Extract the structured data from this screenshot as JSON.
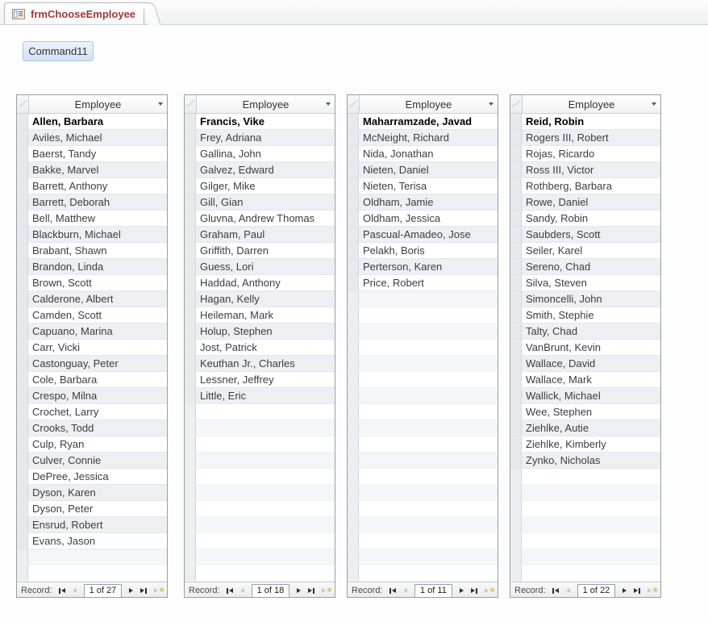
{
  "tab": {
    "label": "frmChooseEmployee",
    "icon": "form-icon"
  },
  "command_button": {
    "label": "Command11"
  },
  "navigator": {
    "record_label": "Record:"
  },
  "colors": {
    "tab_text": "#9e3a38",
    "button_fill": "#d2e2f4",
    "button_border": "#abc6e4",
    "alt_row": "#edeff4",
    "list_border": "#999da1"
  },
  "lists": [
    {
      "header": "Employee",
      "position": "1 of 27",
      "rows": [
        "Allen, Barbara",
        "Aviles, Michael",
        "Baerst, Tandy",
        "Bakke, Marvel",
        "Barrett, Anthony",
        "Barrett, Deborah",
        "Bell, Matthew",
        "Blackburn, Michael",
        "Brabant, Shawn",
        "Brandon, Linda",
        "Brown, Scott",
        "Calderone, Albert",
        "Camden, Scott",
        "Capuano, Marina",
        "Carr, Vicki",
        "Castonguay, Peter",
        "Cole, Barbara",
        "Crespo, Milna",
        "Crochet, Larry",
        "Crooks, Todd",
        "Culp, Ryan",
        "Culver, Connie",
        "DePree, Jessica",
        "Dyson, Karen",
        "Dyson, Peter",
        "Ensrud, Robert",
        "Evans, Jason"
      ]
    },
    {
      "header": "Employee",
      "position": "1 of 18",
      "rows": [
        "Francis, Vike",
        "Frey, Adriana",
        "Gallina, John",
        "Galvez, Edward",
        "Gilger, Mike",
        "Gill, Gian",
        "Gluvna, Andrew Thomas",
        "Graham, Paul",
        "Griffith, Darren",
        "Guess, Lori",
        "Haddad, Anthony",
        "Hagan, Kelly",
        "Heileman, Mark",
        "Holup, Stephen",
        "Jost, Patrick",
        "Keuthan Jr., Charles",
        "Lessner, Jeffrey",
        "Little, Eric"
      ]
    },
    {
      "header": "Employee",
      "position": "1 of 11",
      "rows": [
        "Maharramzade, Javad",
        "McNeight, Richard",
        "Nida, Jonathan",
        "Nieten, Daniel",
        "Nieten, Terisa",
        "Oldham, Jamie",
        "Oldham, Jessica",
        "Pascual-Amadeo, Jose",
        "Pelakh, Boris",
        "Perterson, Karen",
        "Price, Robert"
      ]
    },
    {
      "header": "Employee",
      "position": "1 of 22",
      "rows": [
        "Reid, Robin",
        "Rogers III, Robert",
        "Rojas, Ricardo",
        "Ross III, Victor",
        "Rothberg, Barbara",
        "Rowe, Daniel",
        "Sandy, Robin",
        "Saubders, Scott",
        "Seiler, Karel",
        "Sereno, Chad",
        "Silva, Steven",
        "Simoncelli, John",
        "Smith, Stephie",
        "Talty, Chad",
        "VanBrunt, Kevin",
        "Wallace, David",
        "Wallace, Mark",
        "Wallick, Michael",
        "Wee, Stephen",
        "Ziehlke, Autie",
        "Ziehlke, Kimberly",
        "Zynko, Nicholas"
      ]
    }
  ]
}
